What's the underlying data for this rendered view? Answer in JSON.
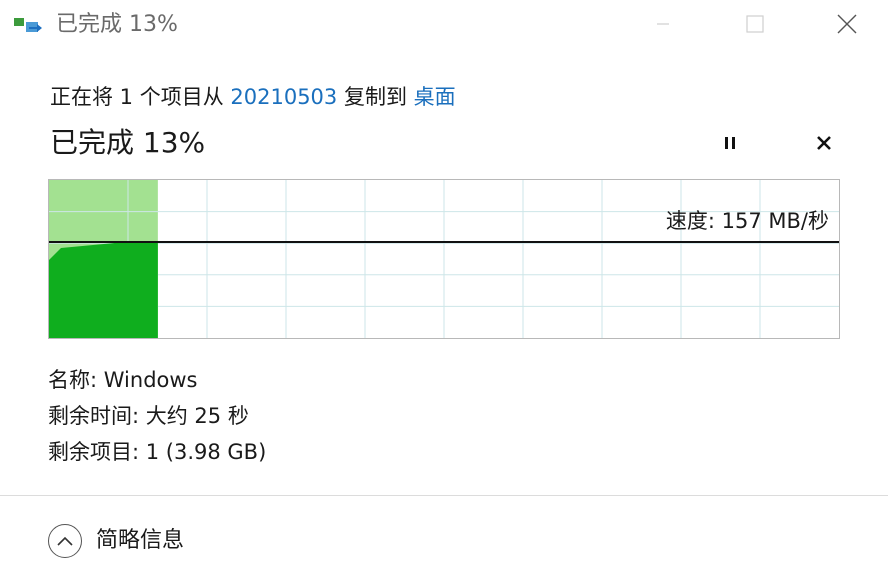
{
  "window": {
    "title": "已完成 13%",
    "icon": "copy-file-icon"
  },
  "header": {
    "copy_prefix": "正在将 1 个项目从 ",
    "source": "20210503",
    "copy_middle": " 复制到 ",
    "destination": "桌面",
    "progress_title": "已完成 13%"
  },
  "progress": {
    "percent": 13,
    "speed_label": "速度: 157 MB/秒"
  },
  "details": {
    "name": "名称: Windows",
    "time_remaining": "剩余时间: 大约 25 秒",
    "items_remaining": "剩余项目: 1 (3.98 GB)"
  },
  "footer": {
    "less_info_label": "简略信息"
  },
  "colors": {
    "graph_fill": "#0fae1e",
    "graph_progress_fill": "#a3e191",
    "graph_grid": "#cde6e8",
    "link": "#1a6fbd"
  },
  "icons": {
    "pause": "pause-icon",
    "cancel": "close-icon",
    "less_info": "chevron-up-icon",
    "minimize": "minimize-icon",
    "maximize": "maximize-icon",
    "close": "close-icon"
  }
}
